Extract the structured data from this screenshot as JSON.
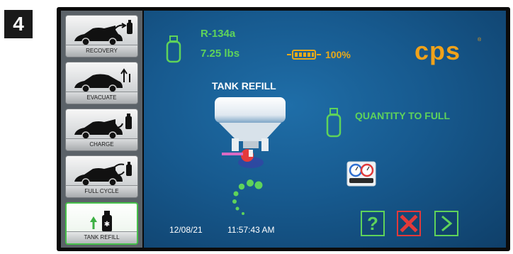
{
  "step_number": "4",
  "sidebar": {
    "items": [
      {
        "label": "RECOVERY",
        "icon": "car-recovery-icon",
        "active": false
      },
      {
        "label": "EVACUATE",
        "icon": "car-evacuate-icon",
        "active": false
      },
      {
        "label": "CHARGE",
        "icon": "car-charge-icon",
        "active": false
      },
      {
        "label": "FULL CYCLE",
        "icon": "car-full-cycle-icon",
        "active": false
      },
      {
        "label": "TANK REFILL",
        "icon": "tank-refill-icon",
        "active": true
      }
    ]
  },
  "status": {
    "refrigerant": "R-134a",
    "weight": "7.25 lbs",
    "battery_percent": "100%"
  },
  "brand": {
    "logo_text": "cps",
    "registered_mark": "®"
  },
  "main": {
    "title": "TANK REFILL",
    "quantity_label": "QUANTITY TO FULL"
  },
  "footer": {
    "date": "12/08/21",
    "time": "11:57:43 AM",
    "help_label": "?"
  },
  "colors": {
    "accent_green": "#5fd35a",
    "battery_amber": "#e8a919",
    "logo_orange": "#f0a21a",
    "cancel_red": "#e33a3a",
    "screen_blue": "#175a8f"
  }
}
